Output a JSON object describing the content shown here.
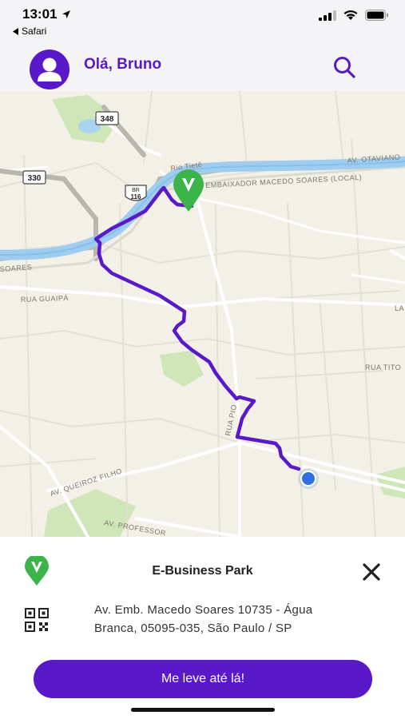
{
  "status_bar": {
    "time": "13:01",
    "back_app": "Safari"
  },
  "header": {
    "greeting": "Olá, Bruno"
  },
  "map": {
    "labels": {
      "br348": "348",
      "sp330": "330",
      "br116_a": "BR",
      "br116_b": "116",
      "rio": "Rio Tietê",
      "av_embaixador": "AV. EMBAIXADOR MACEDO SOARES (LOCAL)",
      "av_otaviano": "AV. OTAVIANO",
      "soares": "SOARES",
      "rua_guaipa": "RUA GUAIPÁ",
      "rua_tito": "RUA TITO",
      "rua_pio": "RUA PIO",
      "av_queiroz": "AV. QUEIROZ FILHO",
      "av_professor": "AV. PROFESSOR",
      "la": "LA"
    },
    "route_color": "#5a19c8",
    "pin_color": "#3bb44a",
    "user_dot_color": "#2f6fe0"
  },
  "sheet": {
    "title": "E-Business Park",
    "address_line1": "Av. Emb. Macedo Soares 10735 - Água",
    "address_line2": "Branca, 05095-035, São Paulo / SP",
    "cta_label": "Me leve até lá!"
  },
  "colors": {
    "brand": "#5a19c8",
    "accent_green": "#3bb44a"
  }
}
